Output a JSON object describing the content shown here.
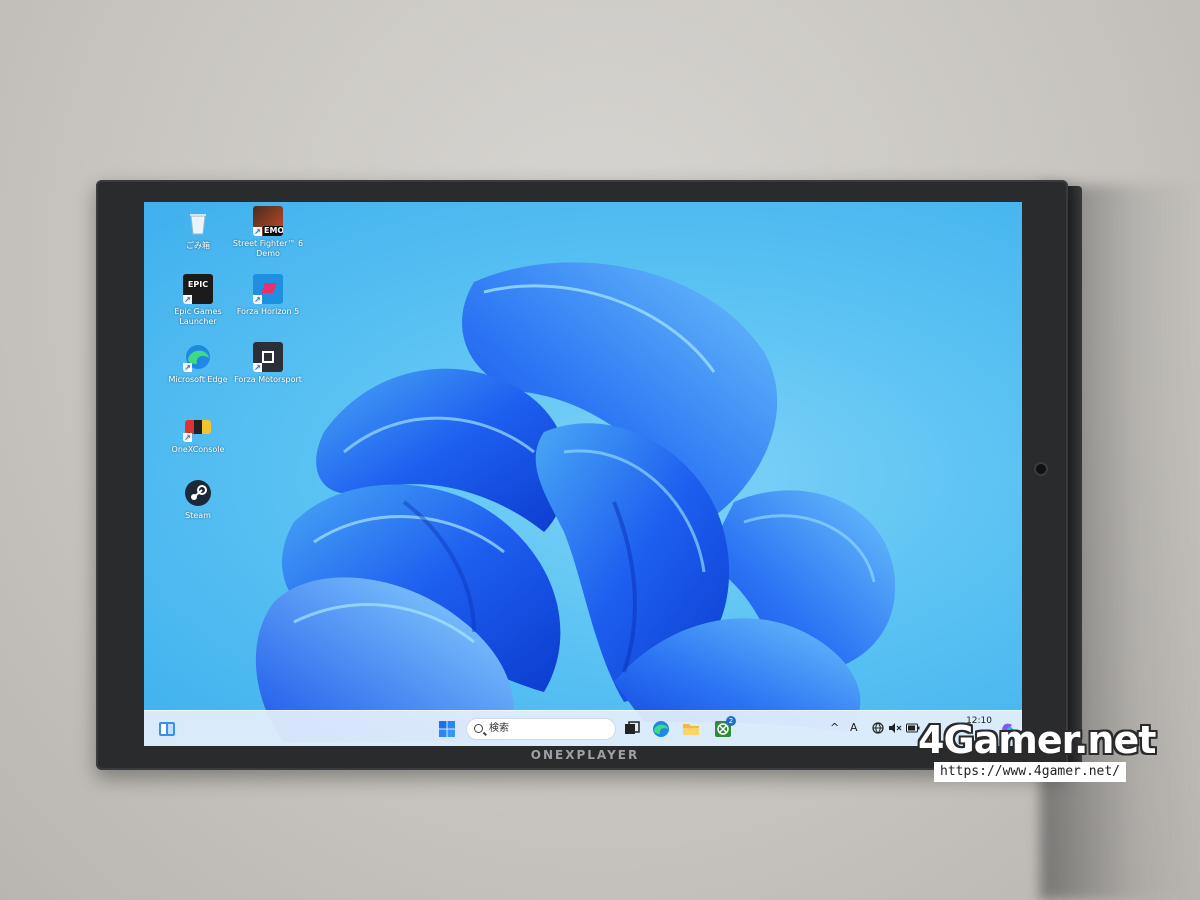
{
  "device": {
    "brand": "ONEXPLAYER"
  },
  "desktop": {
    "icons": [
      {
        "label": "ごみ箱",
        "icon": "recycle-bin-icon"
      },
      {
        "label": "Street Fighter™ 6 Demo",
        "icon": "street-fighter-icon",
        "tile_text": "EMO"
      },
      {
        "label": "Epic Games Launcher",
        "icon": "epic-games-icon",
        "tile_text": "EPIC"
      },
      {
        "label": "Forza Horizon 5",
        "icon": "forza-horizon-icon"
      },
      {
        "label": "Microsoft Edge",
        "icon": "edge-icon"
      },
      {
        "label": "Forza Motorsport",
        "icon": "forza-motorsport-icon"
      },
      {
        "label": "OneXConsole",
        "icon": "onexconsole-icon"
      },
      {
        "label": "Steam",
        "icon": "steam-icon"
      }
    ]
  },
  "taskbar": {
    "search_placeholder": "検索",
    "pinned": [
      "task-view-icon",
      "edge-icon",
      "file-explorer-icon",
      "xbox-icon"
    ],
    "xbox_badge": "2",
    "tray": {
      "chevron": "^",
      "ime": "A",
      "clock_time": "12:10"
    }
  },
  "watermark": {
    "logo": "4Gamer.net",
    "url": "https://www.4gamer.net/"
  },
  "colors": {
    "wallpaper": "#5cc3f3",
    "bloom": "#1e5ff0",
    "bezel": "#2a2b2d"
  }
}
